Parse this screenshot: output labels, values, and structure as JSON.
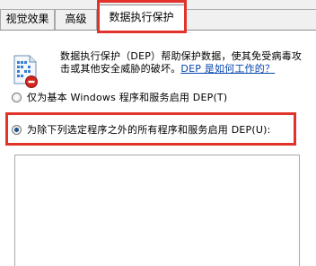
{
  "tabs": [
    {
      "label": "视觉效果"
    },
    {
      "label": "高级"
    },
    {
      "label": "数据执行保护",
      "active": true
    },
    {
      "label": ""
    }
  ],
  "description": {
    "text": "数据执行保护（DEP）帮助保护数据，使其免受病毒攻击或其他安全威胁的破坏。",
    "link_text": "DEP 是如何工作的？"
  },
  "options": {
    "essential_only": {
      "label": "仅为基本 Windows 程序和服务启用 DEP(T)",
      "checked": false
    },
    "all_except": {
      "label": "为除下列选定程序之外的所有程序和服务启用 DEP(U):",
      "checked": true
    }
  },
  "colors": {
    "highlight": "#e1332c",
    "link": "#0645ad",
    "radio_dot": "#1d4f8e"
  },
  "icons": {
    "dep": "dep-shield-icon"
  }
}
